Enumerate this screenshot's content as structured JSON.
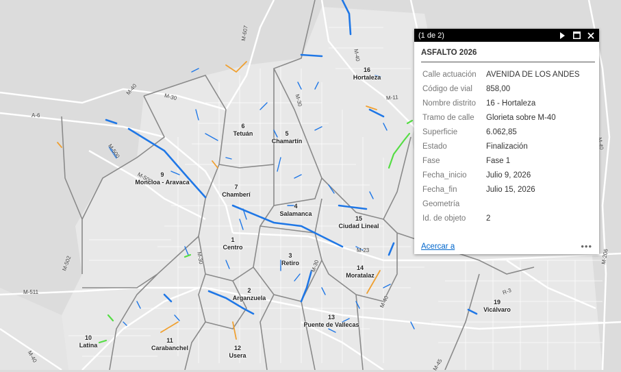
{
  "popup": {
    "count_text": "(1 de 2)",
    "title": "ASFALTO 2026",
    "fields": [
      {
        "key": "Calle actuación",
        "value": "AVENIDA DE LOS ANDES"
      },
      {
        "key": "Código de vial",
        "value": "858,00"
      },
      {
        "key": "Nombre distrito",
        "value": "16 - Hortaleza"
      },
      {
        "key": "Tramo de calle",
        "value": "Glorieta sobre M-40"
      },
      {
        "key": "Superficie",
        "value": "6.062,85"
      },
      {
        "key": "Estado",
        "value": "Finalización"
      },
      {
        "key": "Fase",
        "value": "Fase 1"
      },
      {
        "key": "Fecha_inicio",
        "value": "Julio 9, 2026"
      },
      {
        "key": "Fecha_fin",
        "value": "Julio 15, 2026"
      },
      {
        "key": "Geometría",
        "value": ""
      },
      {
        "key": "Id. de objeto",
        "value": "2"
      }
    ],
    "zoom_link": "Acercar a",
    "more_label": "•••",
    "icons": [
      "next-icon",
      "maximize-icon",
      "close-icon"
    ]
  },
  "map": {
    "districts": [
      {
        "num": "1",
        "name": "Centro"
      },
      {
        "num": "2",
        "name": "Arganzuela"
      },
      {
        "num": "3",
        "name": "Retiro"
      },
      {
        "num": "4",
        "name": "Salamanca"
      },
      {
        "num": "5",
        "name": "Chamartín"
      },
      {
        "num": "6",
        "name": "Tetuán"
      },
      {
        "num": "7",
        "name": "Chamberí"
      },
      {
        "num": "9",
        "name": "Moncloa - Aravaca"
      },
      {
        "num": "10",
        "name": "Latina"
      },
      {
        "num": "11",
        "name": "Carabanchel"
      },
      {
        "num": "12",
        "name": "Usera"
      },
      {
        "num": "13",
        "name": "Puente de Vallecas"
      },
      {
        "num": "14",
        "name": "Moratalaz"
      },
      {
        "num": "15",
        "name": "Ciudad Lineal"
      },
      {
        "num": "16",
        "name": "Hortaleza"
      },
      {
        "num": "19",
        "name": "Vicálvaro"
      }
    ],
    "roads": [
      "M-607",
      "M-40",
      "M-40",
      "M-30",
      "A-6",
      "M-500",
      "M-500",
      "M-30",
      "M-30",
      "M-11",
      "M-23",
      "M-30",
      "M-40",
      "M-502",
      "M-511",
      "M-40",
      "R-3",
      "M-206",
      "M-40",
      "M-45"
    ],
    "colors": {
      "background": "#dcdcdc",
      "water_park": "#e6e6e6",
      "street": "#ffffff",
      "district_border": "#8a8a8a",
      "works_blue": "#1f77e6",
      "works_orange": "#f0a030",
      "works_green": "#55dd44",
      "popup_header": "#000000",
      "link": "#0066cc"
    }
  }
}
